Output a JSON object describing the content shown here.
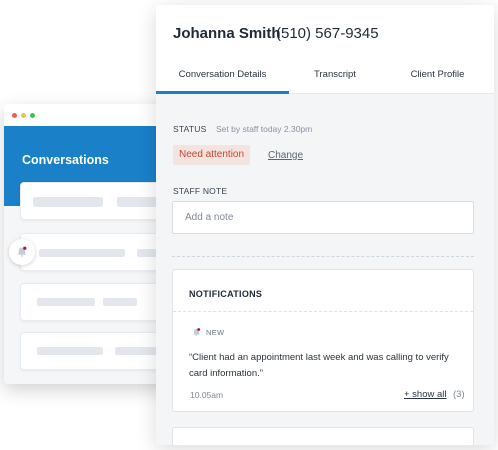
{
  "background_app": {
    "title": "Conversations",
    "traffic_lights": [
      "#ec5f57",
      "#f5bf45",
      "#36c84a"
    ],
    "header_color": "#1a80c8"
  },
  "contact": {
    "name": "Johanna Smith",
    "phone": "(510) 567-9345"
  },
  "tabs": [
    {
      "label": "Conversation Details",
      "active": true
    },
    {
      "label": "Transcript",
      "active": false
    },
    {
      "label": "Client Profile",
      "active": false
    }
  ],
  "status": {
    "label": "STATUS",
    "meta": "Set by staff today 2.30pm",
    "value": "Need attention",
    "change_label": "Change"
  },
  "staff_note": {
    "label": "STAFF NOTE",
    "placeholder": "Add a note",
    "value": ""
  },
  "notifications": {
    "title": "NOTIFICATIONS",
    "item": {
      "tag": "NEW",
      "message": "“Client had an appointment last week and was calling to verify card information.”",
      "time": "10.05am"
    },
    "show_all_label": "+ show all",
    "count": "(3)"
  },
  "icons": {
    "bell": "bell-icon"
  },
  "colors": {
    "accent": "#1a80c8",
    "badge_bg": "#f4e4e0",
    "badge_text": "#c7472f",
    "notification_dot": "#b0123a"
  }
}
